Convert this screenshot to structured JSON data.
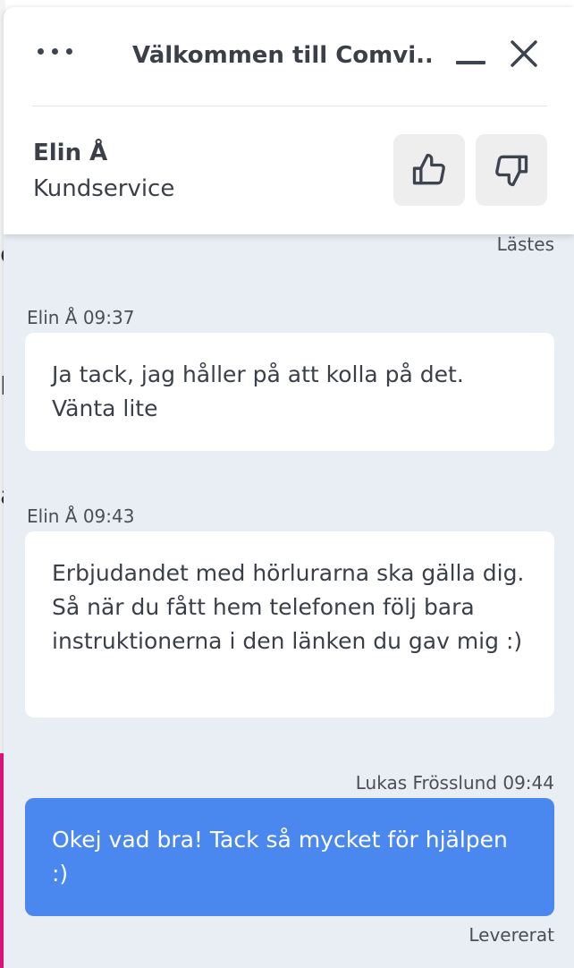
{
  "header": {
    "title": "Välkommen till Comvi...",
    "more_icon": "more-horizontal-icon",
    "minimize_icon": "minimize-icon",
    "close_icon": "close-icon"
  },
  "agent": {
    "name": "Elin Å",
    "role": "Kundservice"
  },
  "rating": {
    "up_icon": "thumbs-up-icon",
    "down_icon": "thumbs-down-icon"
  },
  "messages": [
    {
      "status": "Lästes"
    },
    {
      "sender": "Elin Å 09:37",
      "text": "Ja tack, jag håller på att kolla på det. Vänta lite",
      "from": "agent"
    },
    {
      "sender": "Elin Å 09:43",
      "text": "Erbjudandet med hörlurarna ska gälla dig. Så när du fått hem telefonen följ bara instruktionerna i den länken du gav mig :)",
      "from": "agent"
    },
    {
      "sender": "Lukas Frösslund 09:44",
      "text": "Okej vad bra! Tack så mycket för hjälpen :)",
      "from": "user",
      "status": "Levererat"
    }
  ],
  "colors": {
    "user_bubble": "#4a88ef",
    "chat_background": "#e9edf4",
    "accent_pink": "#e2157a"
  }
}
